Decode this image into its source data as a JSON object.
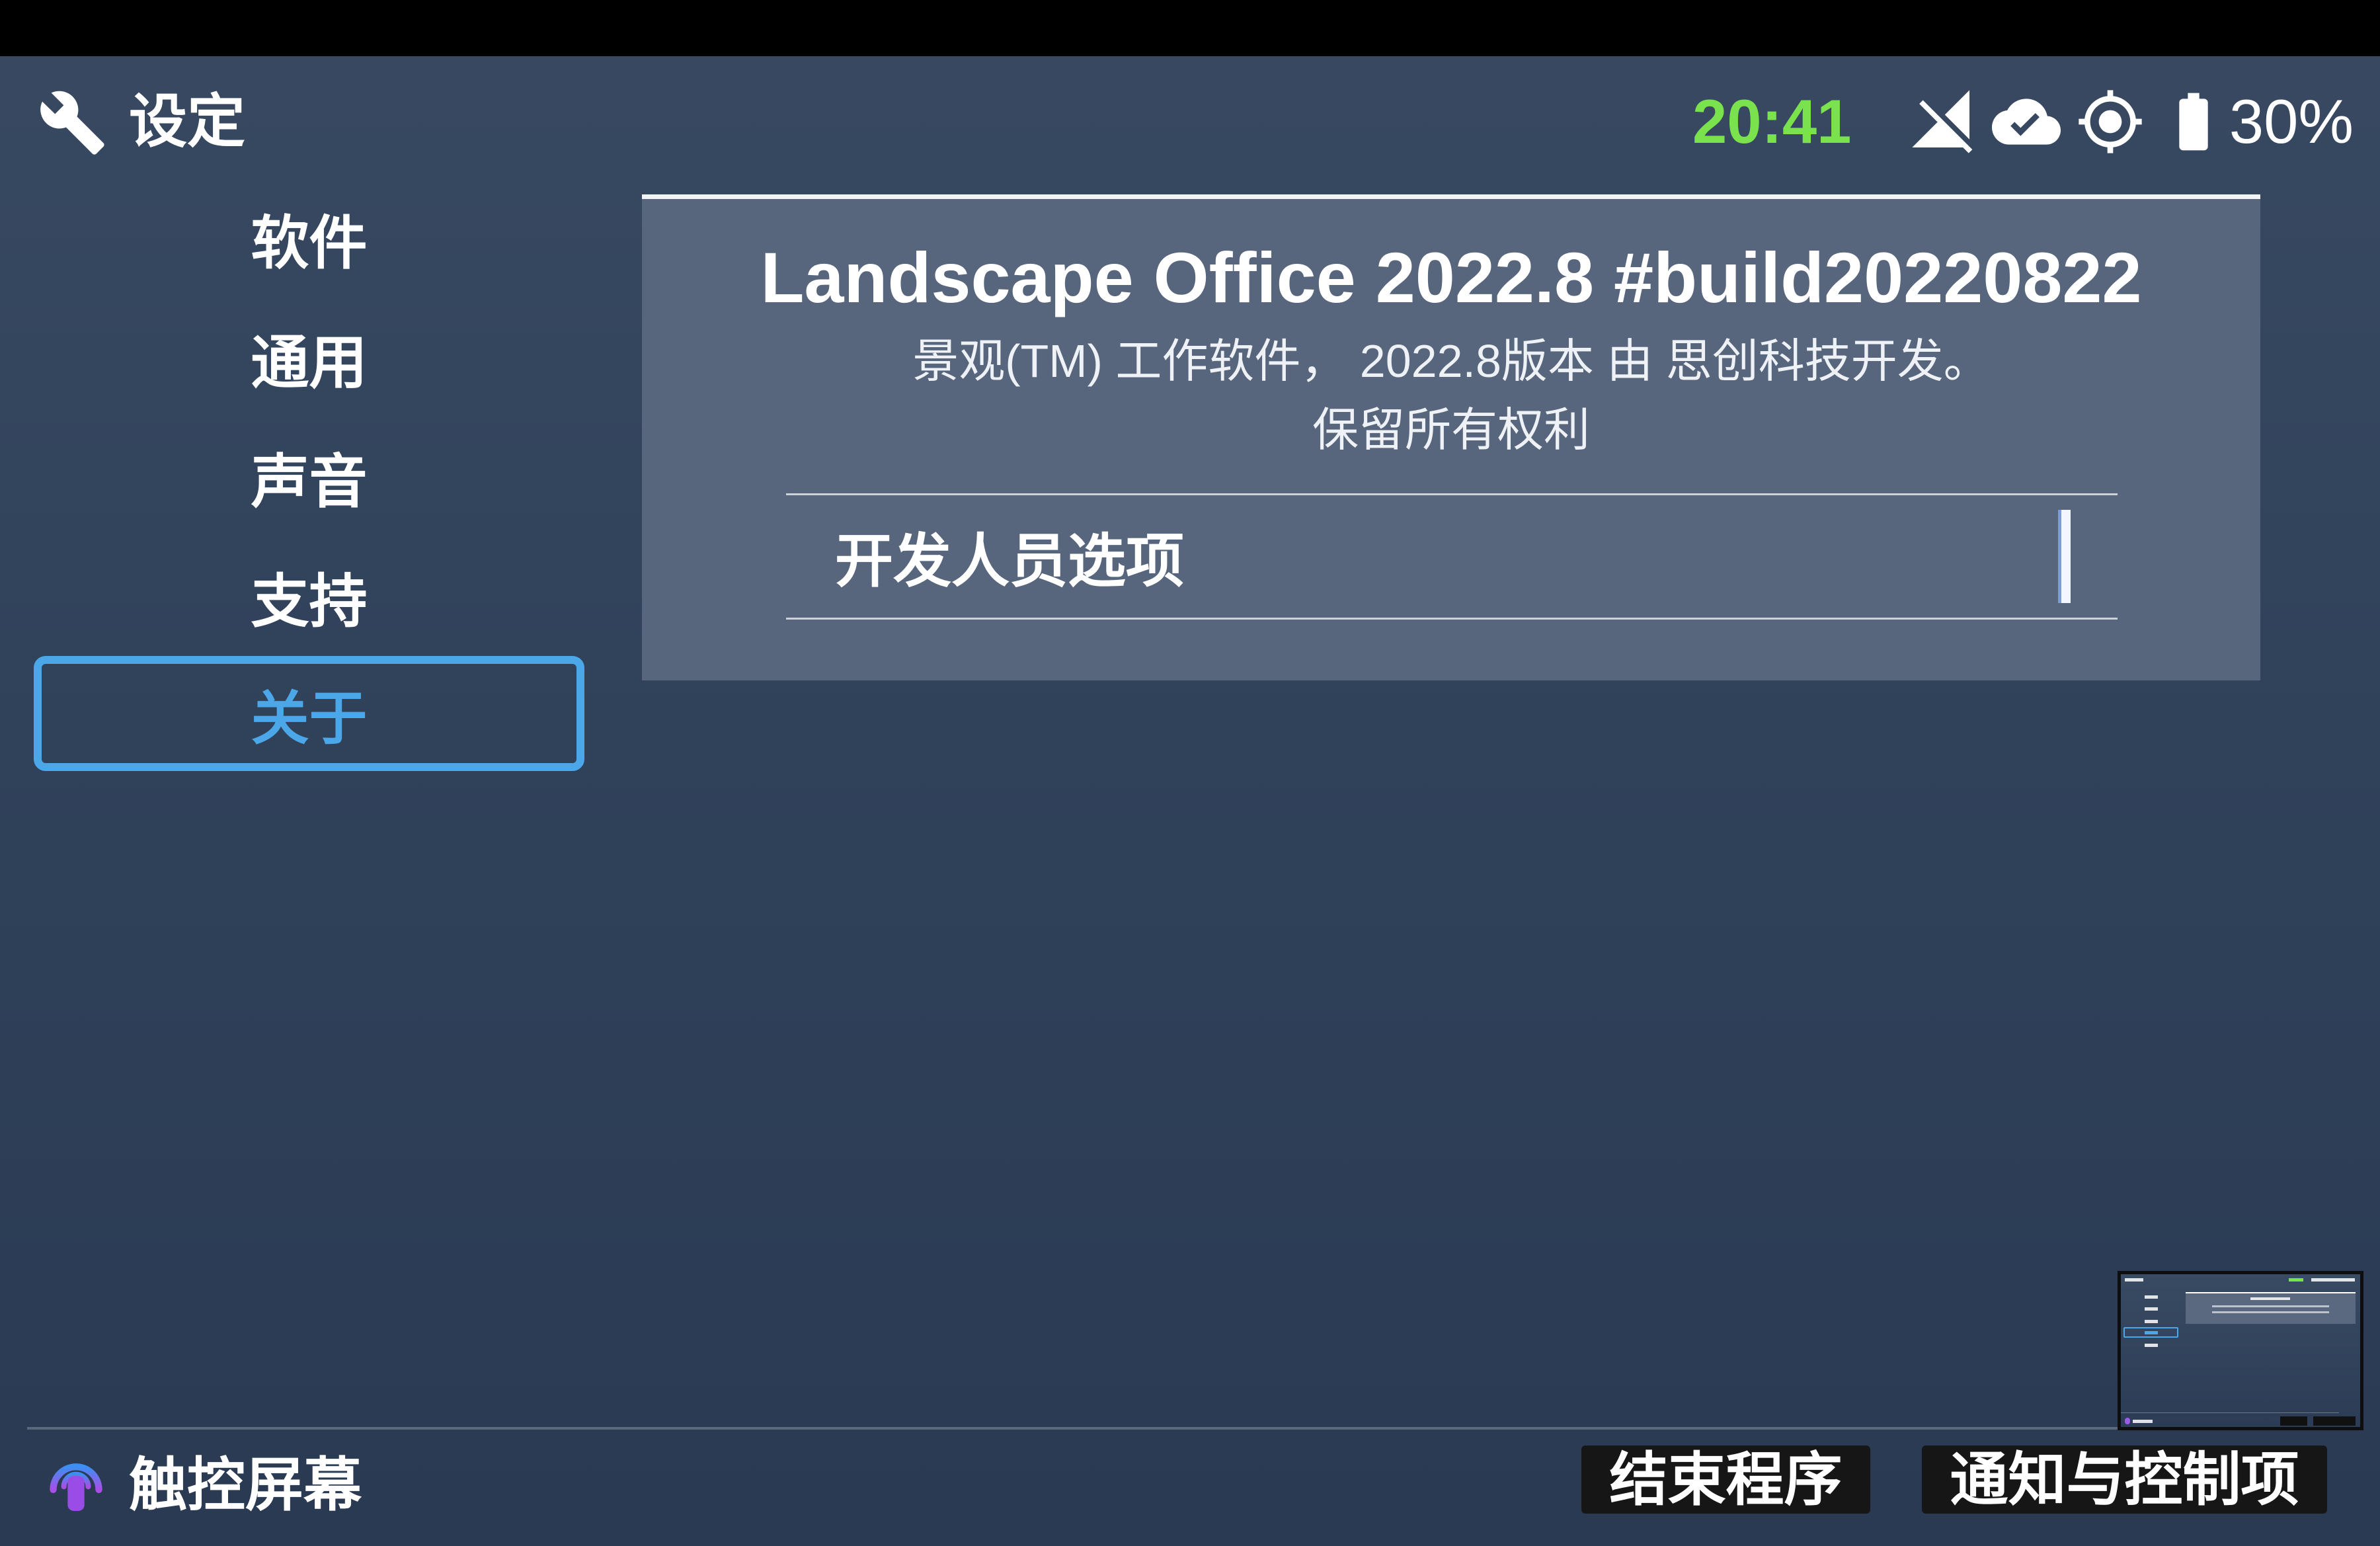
{
  "header": {
    "title": "设定",
    "time": "20:41",
    "battery_percent": "30%"
  },
  "sidebar": {
    "items": [
      {
        "label": "软件",
        "selected": false
      },
      {
        "label": "通用",
        "selected": false
      },
      {
        "label": "声音",
        "selected": false
      },
      {
        "label": "支持",
        "selected": false
      },
      {
        "label": "关于",
        "selected": true
      }
    ]
  },
  "about": {
    "app_title": "Landscape Office 2022.8 #build20220822",
    "description": "景观(TM) 工作软件， 2022.8版本 由 思创科技开发。",
    "rights": "保留所有权利",
    "developer_options": {
      "label": "开发人员选项"
    }
  },
  "footer": {
    "touch_screen_label": "触控屏幕",
    "end_program_label": "结束程序",
    "notifications_label": "通知与控制项"
  },
  "icons": {
    "header": "wrench-icon",
    "signal": "signal-off-icon",
    "cloud": "cloud-done-icon",
    "location": "gps-fixed-icon",
    "battery": "battery-full-icon",
    "touch": "touch-icon"
  },
  "colors": {
    "accent": "#4ba7e8",
    "time_green": "#7ae24c",
    "panel_bg": "#57667c",
    "background": "#2f4059",
    "button_bg": "#161616"
  }
}
